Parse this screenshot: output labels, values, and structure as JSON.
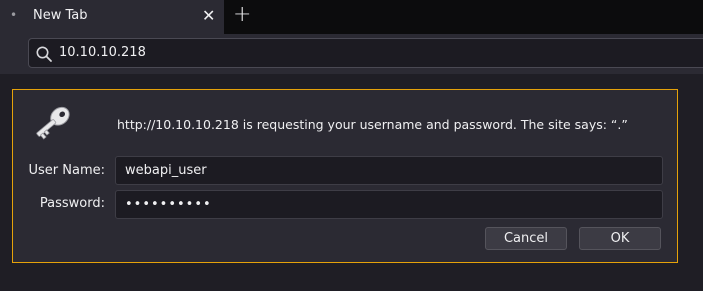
{
  "tab": {
    "indicator": "•",
    "title": "New Tab",
    "close": "✕",
    "new_tab": "+"
  },
  "urlbar": {
    "value": "10.10.10.218"
  },
  "dialog": {
    "message": "http://10.10.10.218 is requesting your username and password. The site says: “.”",
    "username_label": "User Name:",
    "username_value": "webapi_user",
    "password_label": "Password:",
    "password_mask": "••••••••••",
    "cancel_label": "Cancel",
    "ok_label": "OK"
  },
  "colors": {
    "dialog_border": "#e5a20a",
    "background": "#1f1e25",
    "tabbar": "#0c0c0d"
  },
  "icons": [
    "search-icon",
    "key-icon",
    "close-icon",
    "plus-icon"
  ]
}
